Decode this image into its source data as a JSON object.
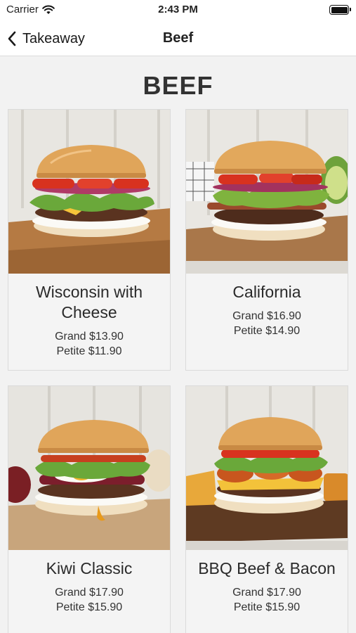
{
  "status": {
    "carrier": "Carrier",
    "time": "2:43 PM",
    "battery_level": 1.0
  },
  "nav": {
    "back_label": "Takeaway",
    "title": "Beef"
  },
  "section": {
    "title": "BEEF"
  },
  "items": [
    {
      "name": "Wisconsin with Cheese",
      "grand": "Grand $13.90",
      "petite": "Petite $11.90",
      "photo": "burger-photo"
    },
    {
      "name": "California",
      "grand": "Grand $16.90",
      "petite": "Petite $14.90",
      "photo": "burger-photo"
    },
    {
      "name": "Kiwi Classic",
      "grand": "Grand $17.90",
      "petite": "Petite $15.90",
      "photo": "burger-photo"
    },
    {
      "name": "BBQ Beef & Bacon",
      "grand": "Grand $17.90",
      "petite": "Petite $15.90",
      "photo": "burger-photo"
    }
  ],
  "colors": {
    "background": "#f2f2f2",
    "card": "#f4f4f4",
    "bun": "#e0a55a",
    "patty": "#5a3320",
    "lettuce": "#6aa83a",
    "tomato": "#d8321f",
    "board": "#b57a43"
  }
}
